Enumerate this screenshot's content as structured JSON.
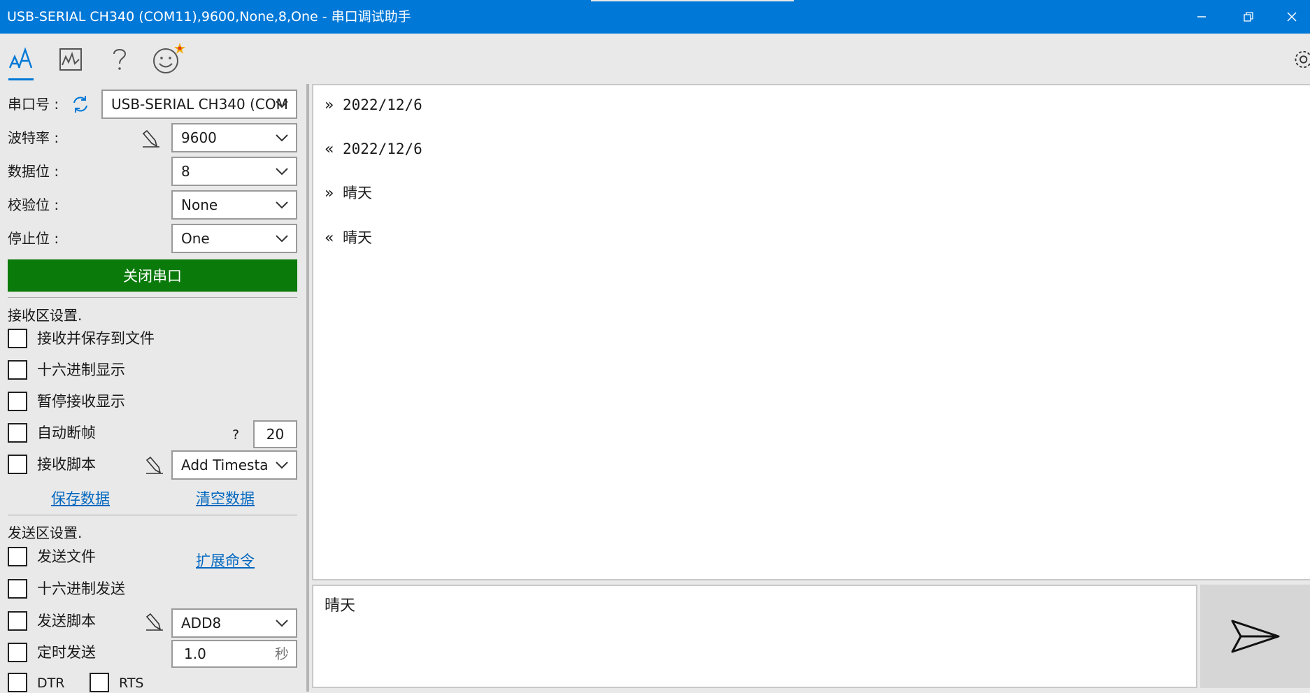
{
  "window": {
    "title": "USB-SERIAL CH340 (COM11),9600,None,8,One - 串口调试助手"
  },
  "toolbar": {
    "icons": [
      "font-aa-icon",
      "chart-icon",
      "help-icon",
      "smiley-icon",
      "gear-icon"
    ],
    "active": "font-aa-icon"
  },
  "serial": {
    "port_label": "串口号 :",
    "port_value": "USB-SERIAL CH340 (COM",
    "baud_label": "波特率 :",
    "baud_value": "9600",
    "databits_label": "数据位 :",
    "databits_value": "8",
    "parity_label": "校验位 :",
    "parity_value": "None",
    "stopbits_label": "停止位 :",
    "stopbits_value": "One",
    "close_button": "关闭串口"
  },
  "receive": {
    "section_title": "接收区设置.",
    "save_to_file": "接收并保存到文件",
    "hex_display": "十六进制显示",
    "pause_display": "暂停接收显示",
    "auto_frame": "自动断帧",
    "auto_frame_help": "?",
    "auto_frame_value": "20",
    "script": "接收脚本",
    "script_value": "Add Timesta",
    "save_data": "保存数据",
    "clear_data": "清空数据"
  },
  "send": {
    "section_title": "发送区设置.",
    "send_file": "发送文件",
    "ext_command": "扩展命令",
    "hex_send": "十六进制发送",
    "script": "发送脚本",
    "script_value": "ADD8",
    "timed_send": "定时发送",
    "interval_value": "1.0",
    "interval_unit": "秒",
    "dtr": "DTR",
    "rts": "RTS"
  },
  "log": [
    {
      "dir": "»",
      "text": "2022/12/6",
      "mono": true
    },
    {
      "dir": "«",
      "text": "2022/12/6",
      "mono": true
    },
    {
      "dir": "»",
      "text": "晴天",
      "mono": false
    },
    {
      "dir": "«",
      "text": "晴天",
      "mono": false
    }
  ],
  "input": {
    "value": "晴天"
  },
  "colors": {
    "titlebar": "#0078d7",
    "accent": "#0078d7",
    "close_button": "#0a7a0a",
    "link": "#0067c0"
  }
}
